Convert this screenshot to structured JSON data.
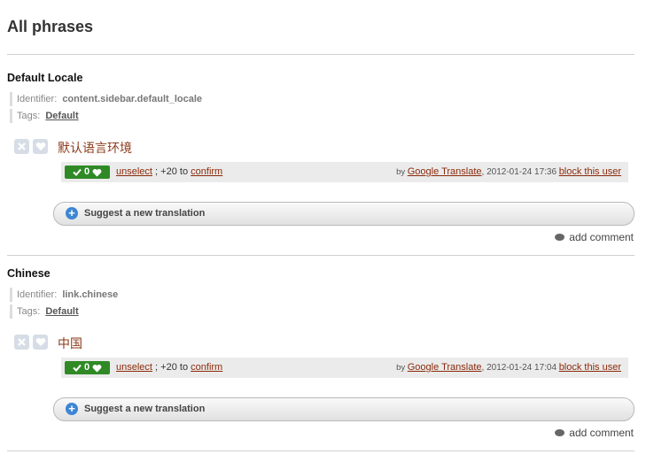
{
  "page": {
    "title": "All phrases"
  },
  "labels": {
    "identifier": "Identifier:",
    "tags": "Tags:",
    "unselect": "unselect",
    "separator": ";",
    "plus_votes": "+20",
    "to": "to",
    "confirm": "confirm",
    "by": "by",
    "block": "block this user",
    "suggest": "Suggest a new translation",
    "add_comment": "add comment"
  },
  "phrases": [
    {
      "title": "Default Locale",
      "identifier": "content.sidebar.default_locale",
      "tag": "Default",
      "translation": "默认语言环境",
      "votes": "0",
      "translator": "Google Translate",
      "timestamp": ", 2012-01-24 17:36"
    },
    {
      "title": "Chinese",
      "identifier": "link.chinese",
      "tag": "Default",
      "translation": "中国",
      "votes": "0",
      "translator": "Google Translate",
      "timestamp": ", 2012-01-24 17:04"
    }
  ],
  "colors": {
    "accent": "#8b2a0a",
    "vote_green": "#2f8a26",
    "suggest_plus": "#3d86d4"
  }
}
